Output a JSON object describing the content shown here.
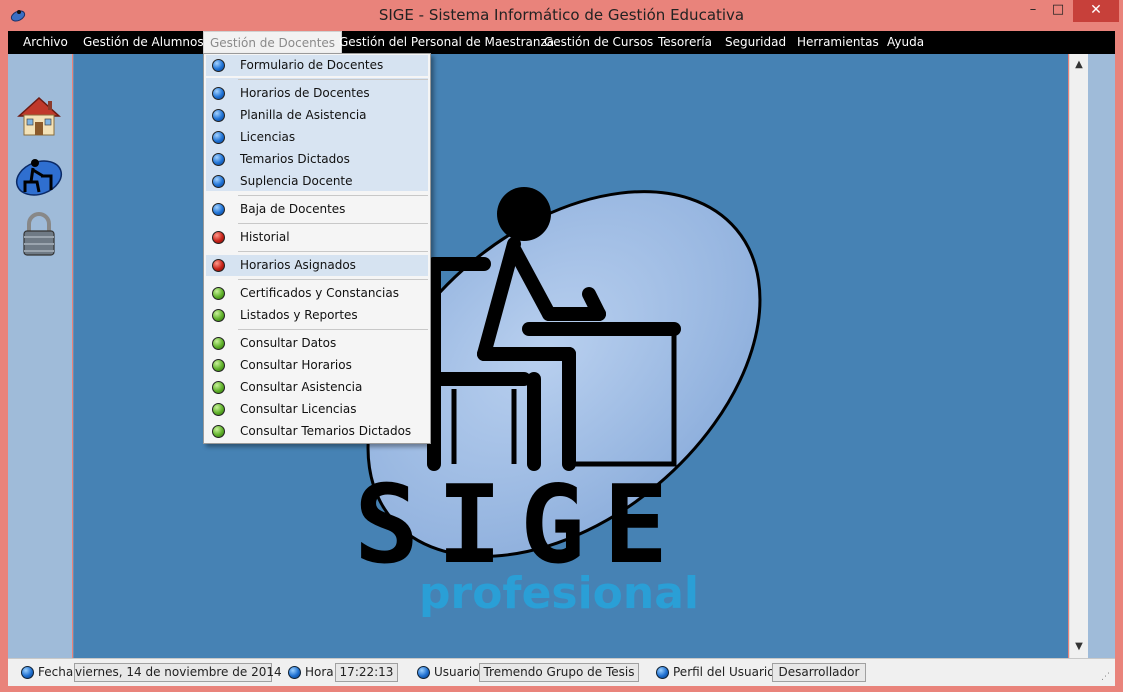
{
  "window": {
    "title": "SIGE - Sistema Informático de Gestión Educativa",
    "controls": {
      "minimize": "–",
      "maximize": "□",
      "close": "✕"
    }
  },
  "menu": {
    "items": [
      {
        "label": "Archivo"
      },
      {
        "label": "Gestión de  Alumnos"
      },
      {
        "label": "Gestión de Docentes",
        "active": true
      },
      {
        "label": "Gestión del Personal de Maestranza"
      },
      {
        "label": "Gestión de Cursos"
      },
      {
        "label": "Tesorería"
      },
      {
        "label": "Seguridad"
      },
      {
        "label": "Herramientas"
      },
      {
        "label": "Ayuda"
      }
    ]
  },
  "dropdown": {
    "items": [
      {
        "label": "Formulario de Docentes",
        "color": "blue"
      },
      {
        "label": "Horarios de Docentes",
        "color": "blue"
      },
      {
        "label": "Planilla de Asistencia",
        "color": "blue"
      },
      {
        "label": "Licencias",
        "color": "blue"
      },
      {
        "label": "Temarios Dictados",
        "color": "blue"
      },
      {
        "label": "Suplencia Docente",
        "color": "blue"
      },
      {
        "label": "Baja de Docentes",
        "color": "blue"
      },
      {
        "label": "Historial",
        "color": "red"
      },
      {
        "label": "Horarios Asignados",
        "color": "red"
      },
      {
        "label": "Certificados y Constancias",
        "color": "green"
      },
      {
        "label": "Listados y Reportes",
        "color": "green"
      },
      {
        "label": "Consultar Datos",
        "color": "green"
      },
      {
        "label": "Consultar Horarios",
        "color": "green"
      },
      {
        "label": "Consultar Asistencia",
        "color": "green"
      },
      {
        "label": "Consultar Licencias",
        "color": "green"
      },
      {
        "label": "Consultar Temarios Dictados",
        "color": "green"
      }
    ]
  },
  "sidebar": {
    "icons": [
      "house-icon",
      "teacher-desk-icon",
      "padlock-icon"
    ]
  },
  "logo": {
    "title": "SIGE",
    "subtitle": "profesional"
  },
  "status": {
    "fecha_label": "Fecha",
    "fecha_value": "viernes, 14 de noviembre de 2014",
    "hora_label": "Hora",
    "hora_value": "17:22:13",
    "usuario_label": "Usuario",
    "usuario_value": "Tremendo Grupo de Tesis",
    "perfil_label": "Perfil del Usuario",
    "perfil_value": "Desarrollador"
  },
  "colors": {
    "titlebar": "#e9837b",
    "main_bg": "#4682b4",
    "menubar": "#000000",
    "side_panel": "#9fbbd9",
    "logo_accent": "#2a9fd6"
  }
}
